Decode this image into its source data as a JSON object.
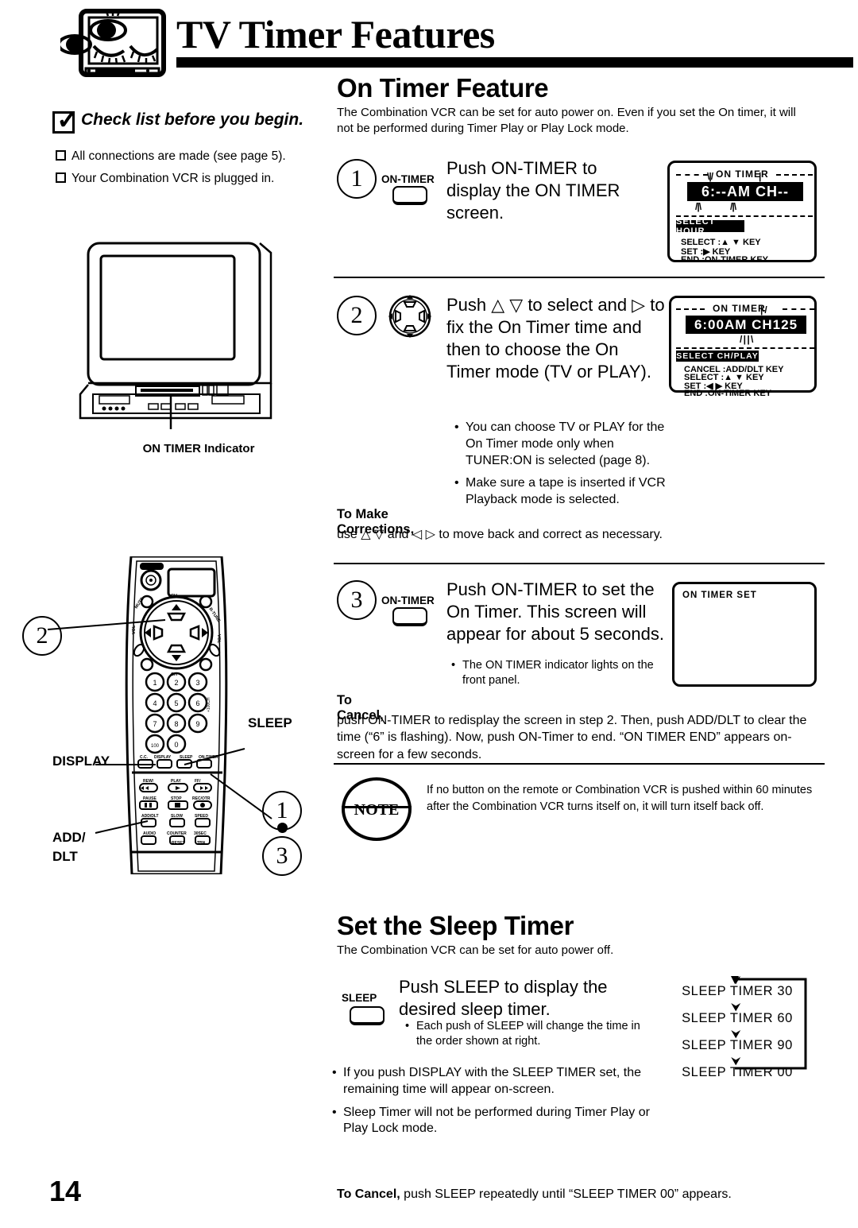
{
  "header": {
    "title": "TV Timer Features",
    "icon": "sleepy-tv-icon"
  },
  "checklist": {
    "title": "Check list before you begin.",
    "items": [
      "All connections are made (see page 5).",
      "Your Combination VCR is plugged in."
    ]
  },
  "tv_illustration": {
    "caption": "ON TIMER Indicator"
  },
  "remote_illustration": {
    "callouts": {
      "sleep": "SLEEP",
      "display": "DISPLAY",
      "add": "ADD/",
      "dlt": "DLT"
    },
    "keypad": [
      "1",
      "2",
      "3",
      "4",
      "5",
      "6",
      "7",
      "8",
      "9",
      "100",
      "0"
    ],
    "function_row": [
      "C.C.",
      "DISPLAY",
      "SLEEP",
      "ON-TIMER"
    ],
    "transport": [
      "REW/◀◀",
      "PLAY",
      "FF/▶▶",
      "PAUSE",
      "STOP",
      "REC/OTR",
      "ADD/DLT",
      "SLOW",
      "SPEED",
      "AUDIO",
      "COUNTER RESET",
      "30SEC TBN"
    ],
    "top_labels": [
      "POWER",
      "MUTE",
      "R-TUNE",
      "CH",
      "VOL",
      "CH"
    ],
    "step_markers": [
      "2",
      "1",
      "3"
    ]
  },
  "on_timer": {
    "heading": "On Timer Feature",
    "intro": "The Combination VCR can be set for auto power on. Even if you set the On timer, it will not be performed during Timer Play or Play Lock mode.",
    "steps": [
      {
        "num": "1",
        "button_label": "ON-TIMER",
        "text": "Push ON-TIMER to display the ON TIMER screen.",
        "screen": {
          "title": "ON TIMER",
          "value": "6:--AM  CH--",
          "mode_bar": "SELECT HOUR",
          "keys": [
            "SELECT :▲ ▼  KEY",
            "SET        :▶  KEY",
            "END        :ON-TIMER KEY"
          ]
        }
      },
      {
        "num": "2",
        "button_label": "d-pad",
        "text": "Push △ ▽ to select and ▷ to fix the On Timer time and then to choose the On Timer mode (TV or PLAY).",
        "bullets": [
          "You can choose TV or PLAY for the On Timer mode only when TUNER:ON is selected (page 8).",
          "Make sure a tape is inserted if VCR Playback mode is selected."
        ],
        "corrections_head": "To Make Corrections,",
        "corrections_body": "use △ ▽ and ◁ ▷ to move back and correct as necessary.",
        "screen": {
          "title": "ON TIMER",
          "value": "6:00AM CH125",
          "mode_bar": "SELECT CH/PLAY",
          "keys": [
            "CANCEL :ADD/DLT  KEY",
            "SELECT  :▲ ▼  KEY",
            "SET         :◀ ▶  KEY",
            "END        :ON-TIMER KEY"
          ]
        }
      },
      {
        "num": "3",
        "button_label": "ON-TIMER",
        "text": "Push ON-TIMER to set the On Timer. This screen will appear for about 5 seconds.",
        "bullets": [
          "The ON TIMER indicator lights on the front panel."
        ],
        "screen": {
          "title": "ON TIMER SET"
        }
      }
    ],
    "cancel_head": "To Cancel,",
    "cancel_body": "push ON-TIMER to redisplay the screen in step 2. Then, push ADD/DLT to clear the time (“6” is flashing). Now, push ON-Timer to end. “ON TIMER END” appears on-screen for a few seconds.",
    "note": {
      "label": "NOTE",
      "body": "If no button on the remote or Combination VCR  is pushed within 60 minutes after the Combination VCR turns itself on, it will turn itself back off."
    }
  },
  "sleep_timer": {
    "heading": "Set the Sleep Timer",
    "intro": "The Combination VCR can be set for auto power off.",
    "button_label": "SLEEP",
    "step_text": "Push SLEEP to display the desired sleep timer.",
    "bullets": [
      "Each push of SLEEP will change the time in the order shown at right.",
      "If you push DISPLAY with the SLEEP TIMER set, the remaining time will appear on-screen.",
      "Sleep Timer will not be performed during Timer Play or Play Lock mode."
    ],
    "cycle": [
      "SLEEP TIMER 30",
      "SLEEP TIMER 60",
      "SLEEP TIMER 90",
      "SLEEP TIMER 00"
    ],
    "cancel_head": "To Cancel,",
    "cancel_body": " push SLEEP repeatedly until “SLEEP TIMER 00” appears."
  },
  "footer": {
    "page_number": "14"
  }
}
